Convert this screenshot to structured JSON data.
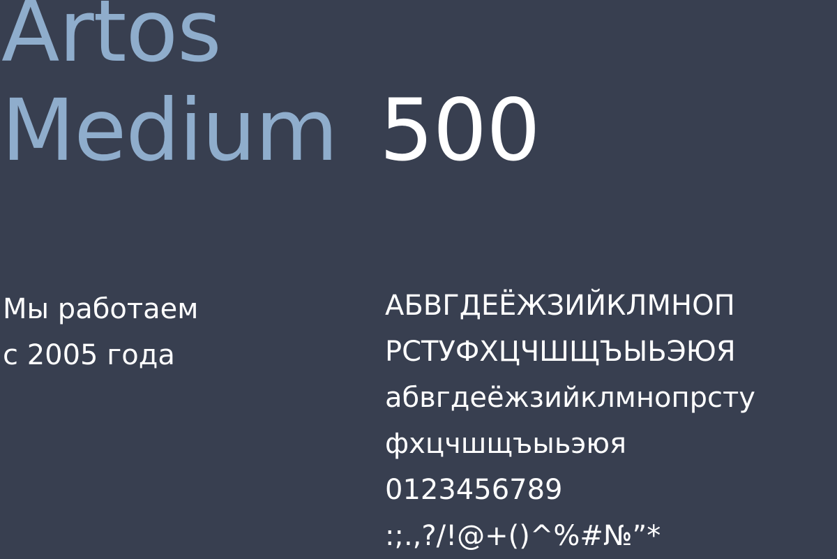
{
  "title": {
    "line1": "Artos",
    "line2": "Medium",
    "weight": "500"
  },
  "tagline": {
    "line1": "Мы работаем",
    "line2": "с 2005 года"
  },
  "specimen": {
    "uppercase_1": "АБВГДЕЁЖЗИЙКЛМНОП",
    "uppercase_2": "РСТУФХЦЧШЩЪЫЬЭЮЯ",
    "lowercase_1": "абвгдеёжзийклмнопрсту",
    "lowercase_2": "фхцчшщъыьэюя",
    "digits": "0123456789",
    "symbols": ":;.,?/!@+()^%#№”*"
  },
  "colors": {
    "background": "#383f50",
    "font_name": "#8fadcc",
    "text": "#ffffff"
  }
}
